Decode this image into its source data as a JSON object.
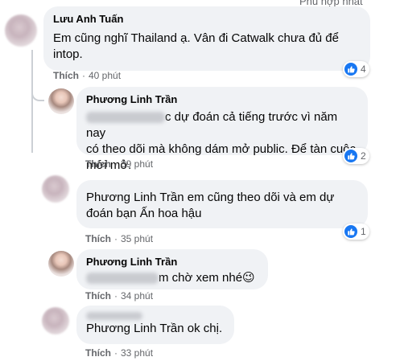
{
  "header": {
    "sort_label": "Phù hợp nhất"
  },
  "comments": [
    {
      "author": "Lưu Anh Tuấn",
      "text_line1": "Em cũng nghĩ Thailand ạ. Vân đi Catwalk chưa đủ để",
      "text_line2": "intop.",
      "like_label": "Thích",
      "time": "40 phút",
      "reactions": "4"
    },
    {
      "author": "Phương Linh Trần",
      "text_line1": "c dự đoán cả tiếng trước vì năm nay",
      "text_line2": "có theo dõi mà không dám mở public. Để tàn cuộc",
      "text_line3": "mới mở.",
      "like_label": "Thích",
      "time": "39 phút",
      "reactions": "2"
    },
    {
      "mention": "Phương Linh Trần",
      "text_line1": "em cũng theo dõi và em dự",
      "text_line2": "đoán bạn Ấn hoa hậu",
      "like_label": "Thích",
      "time": "35 phút",
      "reactions": "1"
    },
    {
      "author": "Phương Linh Trần",
      "text_line1": "m chờ xem nhé",
      "emoji": "😉",
      "like_label": "Thích",
      "time": "34 phút"
    },
    {
      "mention": "Phương Linh Trần",
      "text_line1": "ok chị.",
      "like_label": "Thích",
      "time": "33 phút"
    }
  ],
  "separator": "·"
}
